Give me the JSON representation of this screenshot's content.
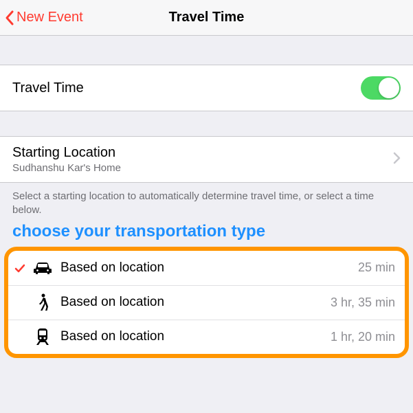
{
  "nav": {
    "back_label": "New Event",
    "title": "Travel Time"
  },
  "toggle": {
    "label": "Travel Time",
    "on": true
  },
  "starting": {
    "title": "Starting Location",
    "detail": "Sudhanshu Kar's Home"
  },
  "footer_note": "Select a starting location to automatically determine travel time, or select a time below.",
  "annotation": "choose your transportation type",
  "transport": [
    {
      "mode": "car",
      "label": "Based on location",
      "time": "25 min",
      "selected": true
    },
    {
      "mode": "walk",
      "label": "Based on location",
      "time": "3 hr, 35 min",
      "selected": false
    },
    {
      "mode": "train",
      "label": "Based on location",
      "time": "1 hr, 20 min",
      "selected": false
    }
  ]
}
